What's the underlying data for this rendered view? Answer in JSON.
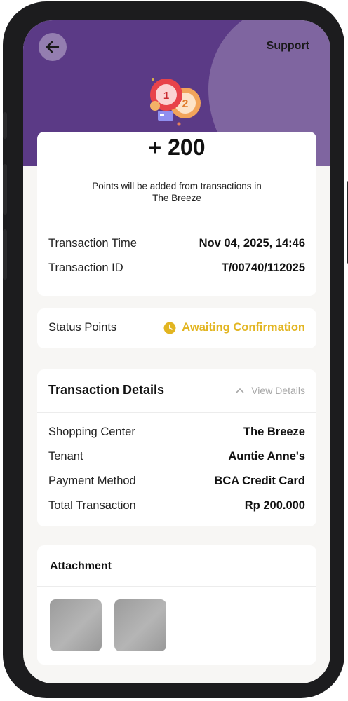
{
  "header": {
    "support_label": "Support"
  },
  "summary": {
    "points": "+ 200",
    "note": "Points will be added from transactions in The Breeze",
    "transaction_time_label": "Transaction Time",
    "transaction_time_value": "Nov 04, 2025, 14:46",
    "transaction_id_label": "Transaction ID",
    "transaction_id_value": "T/00740/112025"
  },
  "status": {
    "label": "Status Points",
    "value": "Awaiting Confirmation",
    "color": "#e2b521"
  },
  "details": {
    "title": "Transaction Details",
    "toggle_label": "View Details",
    "rows": [
      {
        "label": "Shopping Center",
        "value": "The Breeze"
      },
      {
        "label": "Tenant",
        "value": "Auntie Anne's"
      },
      {
        "label": "Payment Method",
        "value": "BCA Credit Card"
      },
      {
        "label": "Total Transaction",
        "value": "Rp 200.000"
      }
    ]
  },
  "attachment": {
    "title": "Attachment"
  },
  "colors": {
    "header_purple": "#5b3a86",
    "background": "#f7f6f4"
  },
  "icons": [
    "back-arrow-icon",
    "poker-chips-icon",
    "clock-icon",
    "chevron-up-icon"
  ]
}
